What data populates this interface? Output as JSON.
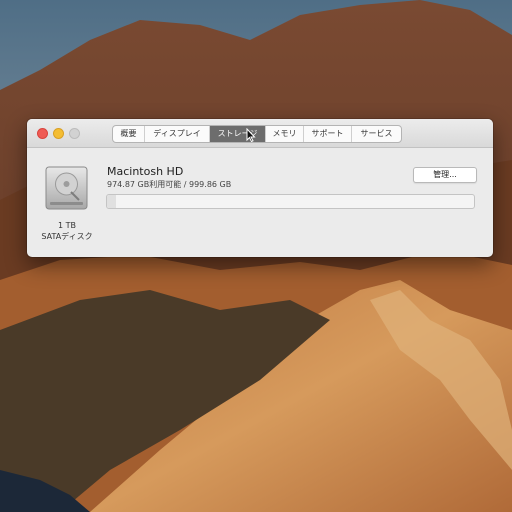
{
  "window": {
    "tabs": [
      {
        "label": "概要"
      },
      {
        "label": "ディスプレイ"
      },
      {
        "label": "ストレージ",
        "selected": true
      },
      {
        "label": "メモリ"
      },
      {
        "label": "サポート"
      },
      {
        "label": "サービス"
      }
    ]
  },
  "storage": {
    "disk_icon": "hard-drive-icon",
    "disk_size": "1 TB",
    "disk_type": "SATAディスク",
    "volume_name": "Macintosh HD",
    "usage_text": "974.87 GB利用可能 / 999.86 GB",
    "used_fraction": 0.025,
    "manage_label": "管理..."
  },
  "colors": {
    "close": "#ef5b54",
    "minimize": "#f4bd33",
    "active_tab": "#6d6d6d"
  }
}
